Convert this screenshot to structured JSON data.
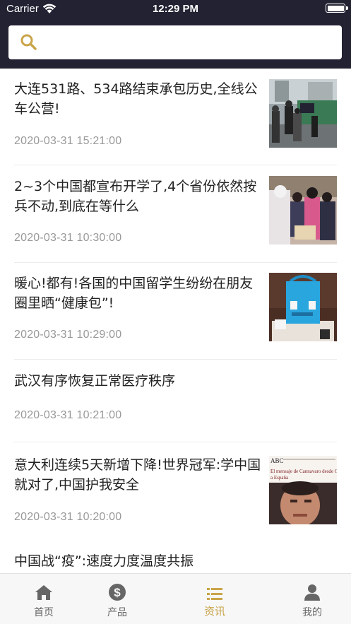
{
  "status_bar": {
    "carrier": "Carrier",
    "time": "12:29 PM"
  },
  "search": {
    "placeholder": "",
    "value": ""
  },
  "news": [
    {
      "title_line1": "大连531路、534路结束承包历史,全线公",
      "title_line2": "车公营!",
      "date": "2020-03-31 15:21:00"
    },
    {
      "title_line1": "2~3个中国都宣布开学了,4个省份依然按",
      "title_line2": "兵不动,到底在等什么",
      "date": "2020-03-31 10:30:00"
    },
    {
      "title_line1": "暖心!都有!各国的中国留学生纷纷在朋友",
      "title_line2": "圈里晒“健康包”!",
      "date": "2020-03-31 10:29:00"
    },
    {
      "title_line1": "武汉有序恢复正常医疗秩序",
      "title_line2": "",
      "date": "2020-03-31 10:21:00"
    },
    {
      "title_line1": "意大利连续5天新增下降!世界冠军:学中国",
      "title_line2": "就对了,中国护我安全",
      "date": "2020-03-31 10:20:00"
    },
    {
      "title_line1": "中国战“疫”:速度力度温度共振",
      "title_line2": "",
      "date": ""
    }
  ],
  "thumb_text": {
    "abc": "ABC",
    "headline1": "El mensaje de Cannavaro desde China",
    "headline2": "a España"
  },
  "tabs": [
    {
      "label": "首页",
      "icon": "home-icon"
    },
    {
      "label": "产品",
      "icon": "dollar-icon"
    },
    {
      "label": "资讯",
      "icon": "list-icon"
    },
    {
      "label": "我的",
      "icon": "user-icon"
    }
  ],
  "colors": {
    "header_bg": "#222233",
    "accent": "#c9a449",
    "date": "#999999"
  }
}
